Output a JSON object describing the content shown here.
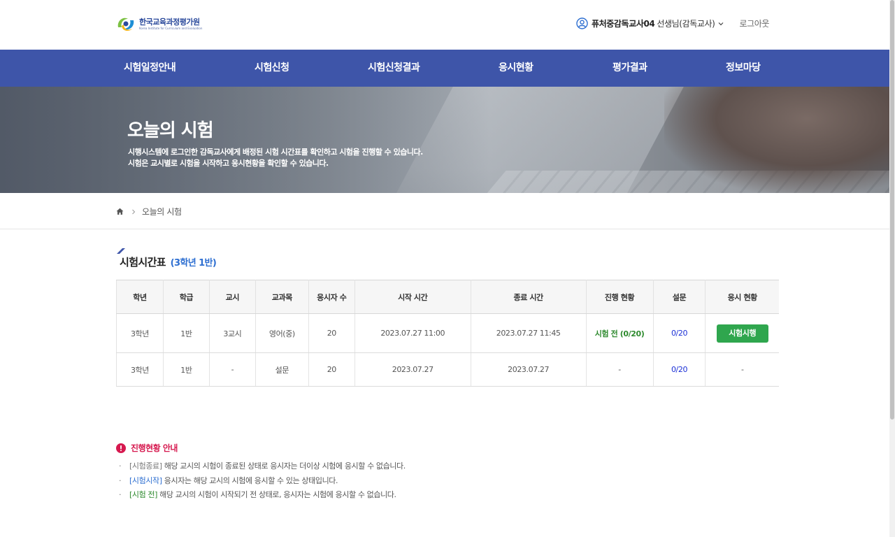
{
  "brand": {
    "logo_text_ko": "한국교육과정평가원",
    "logo_text_en": "Korea Institute for Curriculum and Evaluation"
  },
  "header": {
    "user_name": "퓨처중감독교사04",
    "user_role": "선생님(감독교사)",
    "logout_label": "로그아웃"
  },
  "nav": {
    "items": [
      {
        "label": "시험일정안내"
      },
      {
        "label": "시험신청"
      },
      {
        "label": "시험신청결과"
      },
      {
        "label": "응시현황"
      },
      {
        "label": "평가결과"
      },
      {
        "label": "정보마당"
      }
    ]
  },
  "hero": {
    "title": "오늘의 시험",
    "desc_line1": "시행시스템에 로그인한 감독교사에게 배정된 시험 시간표를 확인하고 시험을 진행할 수 있습니다.",
    "desc_line2": "시험은 교시별로 시험을 시작하고 응시현황을 확인할 수 있습니다."
  },
  "breadcrumb": {
    "current": "오늘의 시험"
  },
  "timetable": {
    "title": "시험시간표",
    "class_label": "(3학년 1반)",
    "headers": [
      "학년",
      "학급",
      "교시",
      "교과목",
      "응시자 수",
      "시작 시간",
      "종료 시간",
      "진행 현황",
      "설문",
      "응시 현황"
    ],
    "rows": [
      {
        "grade": "3학년",
        "class": "1반",
        "period": "3교시",
        "subject": "영어(중)",
        "examinees": "20",
        "start": "2023.07.27 11:00",
        "end": "2023.07.27 11:45",
        "status": "시험 전 (0/20)",
        "survey": "0/20",
        "action": "시험시행"
      },
      {
        "grade": "3학년",
        "class": "1반",
        "period": "-",
        "subject": "설문",
        "examinees": "20",
        "start": "2023.07.27",
        "end": "2023.07.27",
        "status": "-",
        "survey": "0/20",
        "action": "-"
      }
    ]
  },
  "notice": {
    "title": "진행현황 안내",
    "items": [
      {
        "keyword": "[시험종료]",
        "text": " 해당 교시의 시험이 종료된 상태로 응시자는 더이상 시험에 응시할 수 없습니다."
      },
      {
        "keyword": "[시험시작]",
        "text": " 응시자는 해당 교시의 시험에 응시할 수 있는 상태입니다."
      },
      {
        "keyword": "[시험 전]",
        "text": " 해당 교시의 시험이 시작되기 전 상태로, 응시자는 시험에 응시할 수 없습니다."
      }
    ]
  },
  "colors": {
    "nav_bg": "#3e55a9",
    "accent_blue": "#2e6fd1",
    "status_green": "#2e8a2e",
    "button_green": "#2fa64e",
    "notice_red": "#d6194f"
  },
  "icons": [
    "logo-mark-icon",
    "user-circle-icon",
    "chevron-down-icon",
    "home-icon",
    "chevron-right-icon",
    "exclamation-circle-icon"
  ]
}
